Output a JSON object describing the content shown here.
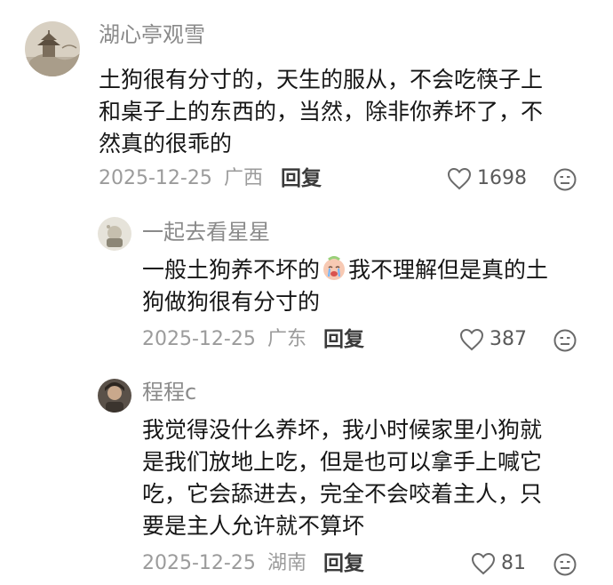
{
  "comments": [
    {
      "username": "湖心亭观雪",
      "lines": [
        "土狗很有分寸的，天生的服从，不会吃筷子上",
        "和桌子上的东西的，当然，除非你养坏了，不",
        "然真的很乖的"
      ],
      "date": "2025-12-25",
      "location": "广西",
      "reply_label": "回复",
      "likes": "1698"
    },
    {
      "username": "一起去看星星",
      "line1_before": "一般土狗养不坏的",
      "line1_after": "我不理解但是真的土",
      "line2": "狗做狗很有分寸的",
      "emoji": "crying-face-emoji",
      "date": "2025-12-25",
      "location": "广东",
      "reply_label": "回复",
      "likes": "387"
    },
    {
      "username": "程程c",
      "lines": [
        "我觉得没什么养坏，我小时候家里小狗就",
        "是我们放地上吃，但是也可以拿手上喊它",
        "吃，它会舔进去，完全不会咬着主人，只",
        "要是主人允许就不算坏"
      ],
      "date": "2025-12-25",
      "location": "湖南",
      "reply_label": "回复",
      "likes": "81"
    }
  ],
  "colors": {
    "username": "#8a8a8a",
    "text": "#161616",
    "meta": "#9b9b9b",
    "reply": "#3a3a3a"
  }
}
